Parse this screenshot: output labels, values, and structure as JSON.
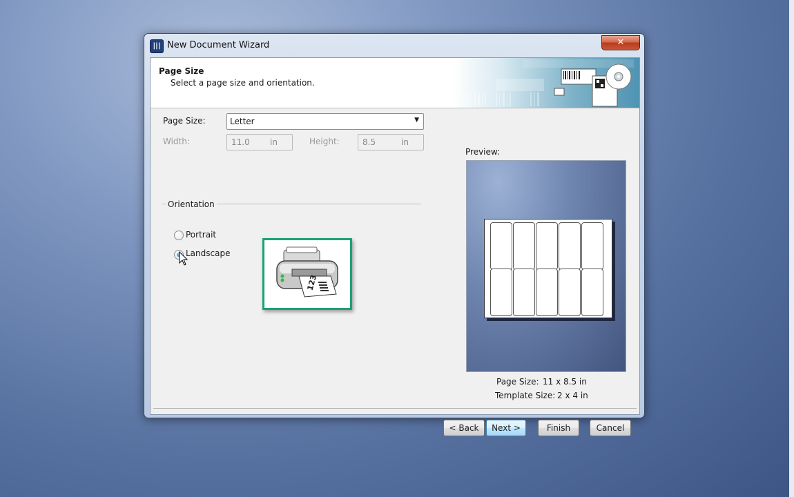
{
  "window": {
    "title": "New Document Wizard",
    "close_label": "✕"
  },
  "banner": {
    "title": "Page Size",
    "subtitle": "Select a page size and orientation."
  },
  "form": {
    "page_size_label": "Page Size:",
    "page_size_value": "Letter",
    "width_label": "Width:",
    "width_value": "11.0",
    "width_unit": "in",
    "height_label": "Height:",
    "height_value": "8.5",
    "height_unit": "in"
  },
  "orientation": {
    "group_label": "Orientation",
    "portrait_label": "Portrait",
    "landscape_label": "Landscape",
    "selected": "Landscape"
  },
  "preview": {
    "label": "Preview:",
    "page_size_label": "Page Size:",
    "page_size_value": "11 x 8.5 in",
    "template_size_label": "Template Size:",
    "template_size_value": "2 x 4 in",
    "label_rows": 2,
    "label_cols": 5
  },
  "buttons": {
    "back": "< Back",
    "next": "Next >",
    "finish": "Finish",
    "cancel": "Cancel"
  },
  "icons": [
    "app-icon",
    "close-icon",
    "dropdown-arrow-icon",
    "printer-icon",
    "mouse-cursor-icon"
  ],
  "colors": {
    "highlight_border": "#1aa272",
    "titlebar": "#c8d6ea",
    "close_button": "#c9563a"
  }
}
